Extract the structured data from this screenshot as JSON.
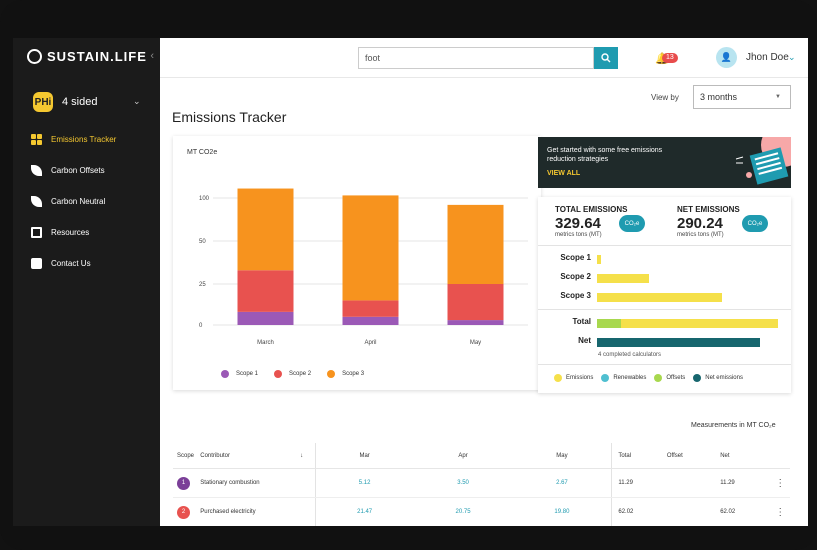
{
  "app": {
    "name": "SUSTAIN.LIFE",
    "collapse_icon": "chevron-left-icon"
  },
  "org": {
    "name": "4 sided",
    "avatar_text": "PHi"
  },
  "sidebar": {
    "items": [
      {
        "label": "Emissions Tracker",
        "icon": "grid-icon",
        "active": true
      },
      {
        "label": "Carbon Offsets",
        "icon": "leaf-icon"
      },
      {
        "label": "Carbon Neutral",
        "icon": "leaf-icon"
      },
      {
        "label": "Resources",
        "icon": "book-icon"
      },
      {
        "label": "Contact Us",
        "icon": "chat-icon"
      }
    ]
  },
  "topbar": {
    "search_value": "foot",
    "notifications_count": "13",
    "user_name": "Jhon Doe"
  },
  "view_by": {
    "label": "View by",
    "value": "3 months"
  },
  "page_title": "Emissions Tracker",
  "chart_data": {
    "type": "bar",
    "stacked": true,
    "ylabel": "MT CO2e",
    "categories": [
      "March",
      "April",
      "May"
    ],
    "series": [
      {
        "name": "Scope 1",
        "color": "#9b59b6",
        "values": [
          8,
          5,
          3
        ]
      },
      {
        "name": "Scope 2",
        "color": "#e8524f",
        "values": [
          25,
          10,
          22
        ]
      },
      {
        "name": "Scope 3",
        "color": "#f7931e",
        "values": [
          78,
          88,
          67
        ]
      }
    ],
    "yticks": [
      "0",
      "25",
      "50",
      "100"
    ]
  },
  "promo": {
    "text": "Get started with some free emissions reduction strategies",
    "link": "VIEW ALL"
  },
  "emissions": {
    "total_label": "TOTAL EMISSIONS",
    "total_value": "329.64",
    "total_unit": "metrics tons (MT)",
    "net_label": "NET EMISSIONS",
    "net_value": "290.24",
    "net_unit": "metrics tons (MT)",
    "cloud_label": "CO₂e",
    "bars": [
      {
        "label": "Scope 1",
        "fraction": 0.02,
        "color": "#f5e04a"
      },
      {
        "label": "Scope 2",
        "fraction": 0.29,
        "color": "#f5e04a"
      },
      {
        "label": "Scope 3",
        "fraction": 0.69,
        "color": "#f5e04a"
      }
    ],
    "total": {
      "label": "Total",
      "fraction": 1.0,
      "renewables_fraction": 0.13
    },
    "net": {
      "label": "Net",
      "fraction": 0.9
    },
    "note": "4 completed calculators",
    "legend": [
      {
        "label": "Emissions",
        "color": "#f5e04a"
      },
      {
        "label": "Renewables",
        "color": "#4fbfd0"
      },
      {
        "label": "Offsets",
        "color": "#a8d84e"
      },
      {
        "label": "Net emissions",
        "color": "#17666e"
      }
    ]
  },
  "measurements_note": "Measurements in MT CO₂e",
  "table": {
    "headers": {
      "scope": "Scope",
      "contributor": "Contributor",
      "sort": "↓",
      "mar": "Mar",
      "apr": "Apr",
      "may": "May",
      "total": "Total",
      "offset": "Offset",
      "net": "Net"
    },
    "rows": [
      {
        "scope": "1",
        "scope_color": "#7b3f98",
        "contributor": "Stationary combustion",
        "mar": "5.12",
        "apr": "3.50",
        "may": "2.67",
        "total": "11.29",
        "offset": "",
        "net": "11.29"
      },
      {
        "scope": "2",
        "scope_color": "#e8524f",
        "contributor": "Purchased electricity",
        "mar": "21.47",
        "apr": "20.75",
        "may": "19.80",
        "total": "62.02",
        "offset": "",
        "net": "62.02"
      }
    ]
  }
}
